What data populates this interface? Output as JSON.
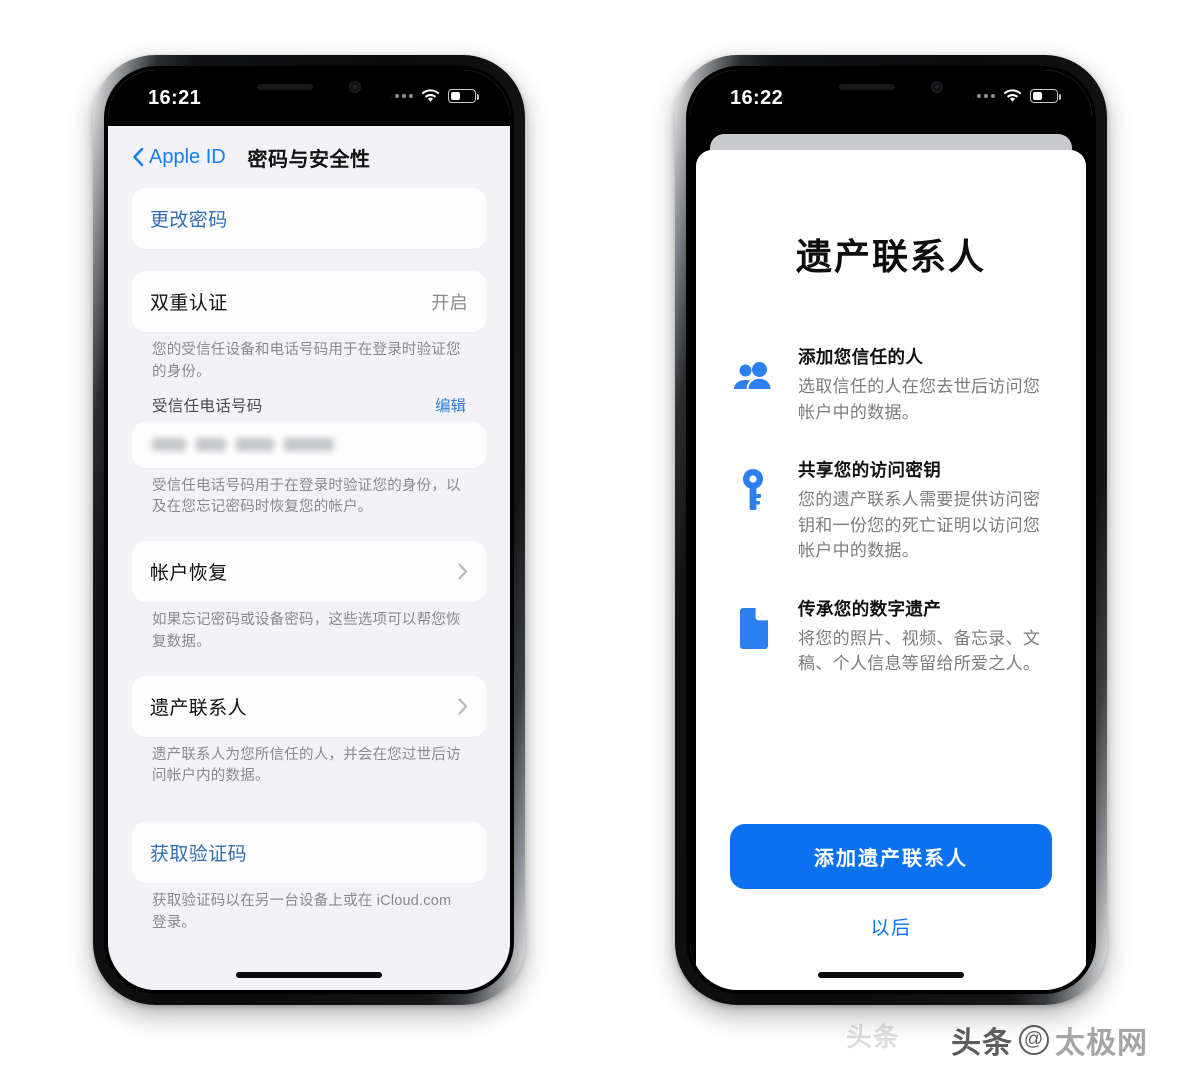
{
  "left_phone": {
    "status_bar": {
      "time": "16:21",
      "wifi_icon": "wifi-icon",
      "battery_icon": "battery-icon",
      "signal_icon": "signal-dots-icon"
    },
    "nav": {
      "back_label": "Apple ID",
      "back_icon": "chevron-left-icon",
      "title": "密码与安全性"
    },
    "sections": {
      "change_password": {
        "label": "更改密码"
      },
      "two_factor": {
        "label": "双重认证",
        "value": "开启",
        "footnote": "您的受信任设备和电话号码用于在登录时验证您的身份。",
        "trusted_number_label": "受信任电话号码",
        "edit_action": "编辑",
        "trusted_number_value": "",
        "trusted_number_footnote": "受信任电话号码用于在登录时验证您的身份，以及在您忘记密码时恢复您的帐户。"
      },
      "account_recovery": {
        "label": "帐户恢复",
        "chevron_icon": "chevron-right-icon",
        "footnote": "如果忘记密码或设备密码，这些选项可以帮您恢复数据。"
      },
      "legacy_contact": {
        "label": "遗产联系人",
        "chevron_icon": "chevron-right-icon",
        "footnote": "遗产联系人为您所信任的人，并会在您过世后访问帐户内的数据。"
      },
      "verification_code": {
        "label": "获取验证码",
        "footnote": "获取验证码以在另一台设备上或在 iCloud.com 登录。"
      }
    }
  },
  "right_phone": {
    "status_bar": {
      "time": "16:22",
      "wifi_icon": "wifi-icon",
      "battery_icon": "battery-icon",
      "signal_icon": "signal-dots-icon"
    },
    "sheet": {
      "title": "遗产联系人",
      "features": [
        {
          "icon": "two-people-icon",
          "title": "添加您信任的人",
          "desc": "选取信任的人在您去世后访问您帐户中的数据。"
        },
        {
          "icon": "key-icon",
          "title": "共享您的访问密钥",
          "desc": "您的遗产联系人需要提供访问密钥和一份您的死亡证明以访问您帐户中的数据。"
        },
        {
          "icon": "document-icon",
          "title": "传承您的数字遗产",
          "desc": "将您的照片、视频、备忘录、文稿、个人信息等留给所爱之人。"
        }
      ],
      "primary_button": "添加遗产联系人",
      "secondary_button": "以后"
    }
  },
  "watermark": {
    "prefix": "头条",
    "at_symbol": "@",
    "name": "太极网",
    "ghost": "头条"
  },
  "colors": {
    "accent_blue": "#0a72ef",
    "link_blue": "#147efb",
    "screen_bg": "#f2f2f7",
    "card_bg": "#fdfdfd",
    "muted_text": "#8a8a8e"
  }
}
